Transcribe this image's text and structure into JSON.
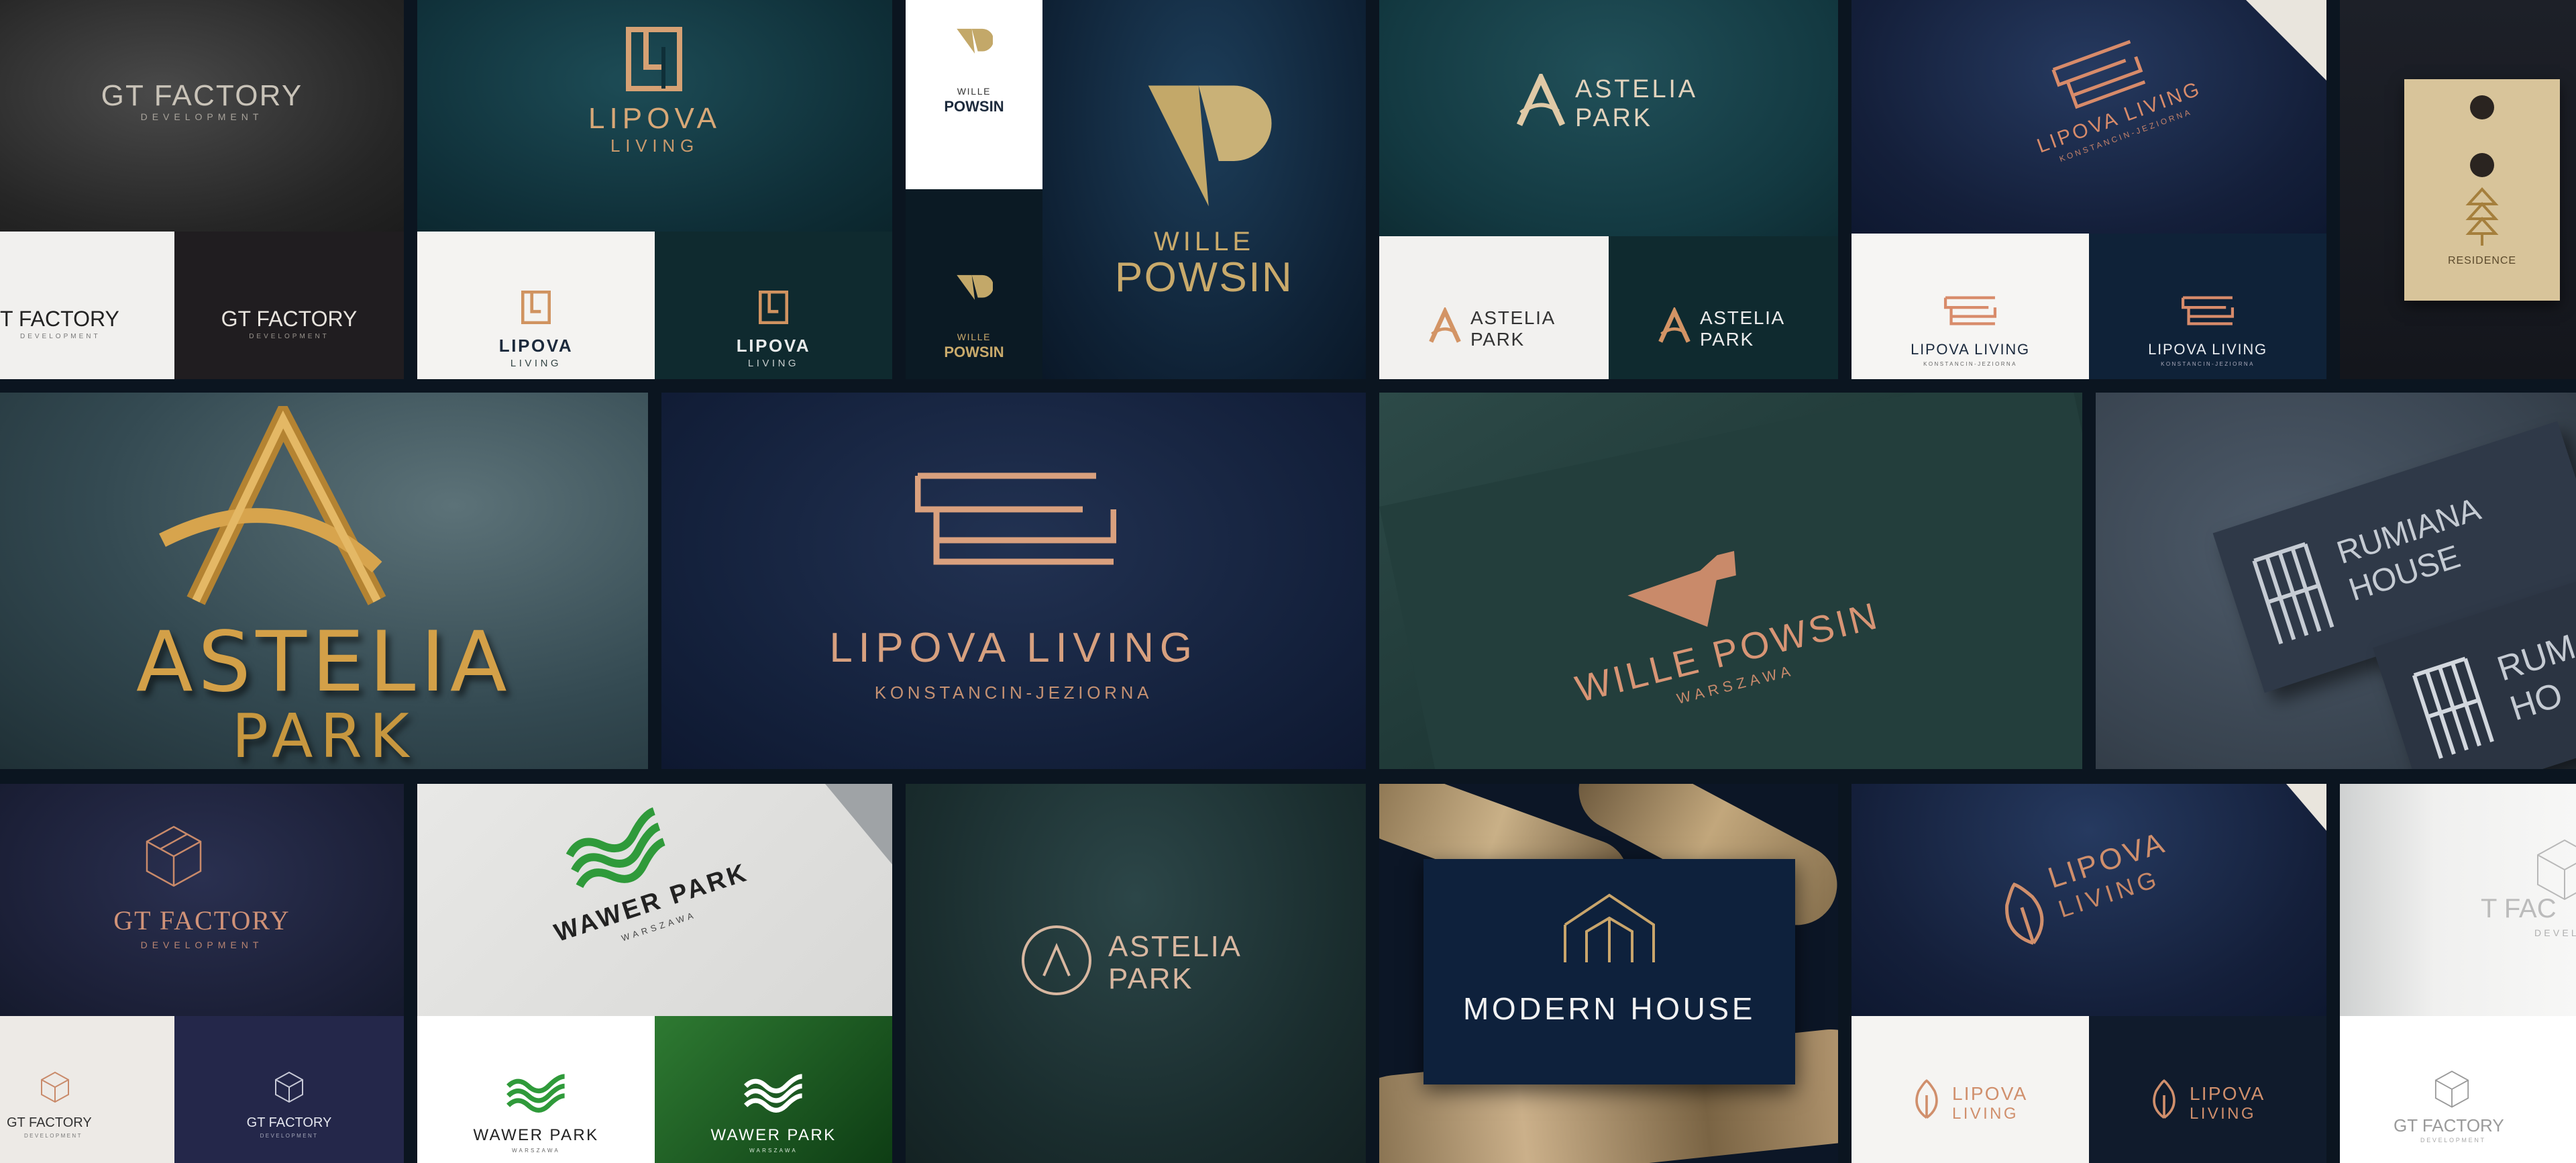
{
  "colors": {
    "background": "#0b1520",
    "gold": "#c9aa6b",
    "copper": "#c98a6a",
    "navy": "#101c33",
    "teal": "#123741",
    "green": "#2f9a3a"
  },
  "brands": {
    "gt_factory": {
      "name": "GT FACTORY",
      "sub": "DEVELOPMENT",
      "clipped_name": "T FACTORY",
      "far_clipped_name": "T FAC",
      "far_clipped_sub": "DEVEL"
    },
    "lipova": {
      "name_line1": "LIPOVA",
      "name_line2": "LIVING",
      "full_name": "LIPOVA LIVING",
      "location": "KONSTANCIN-JEZIORNA"
    },
    "wille": {
      "line1": "WILLE",
      "line2": "POWSIN",
      "full_name": "WILLE POWSIN",
      "location": "WARSZAWA"
    },
    "astelia": {
      "line1": "ASTELIA",
      "line2": "PARK"
    },
    "rumiana": {
      "line1": "RUMIANA",
      "line2": "HOUSE",
      "clip1": "RUM",
      "clip2": "HO"
    },
    "residence": {
      "name": "RESIDENCE"
    },
    "wawer": {
      "name": "WAWER PARK",
      "location": "WARSZAWA"
    },
    "modern_house": {
      "name": "MODERN HOUSE"
    }
  },
  "icons": {
    "gt": "geometric-cube-icon",
    "lipova_mono": "lipova-square-monogram-icon",
    "lipova_stripes": "lipova-stripes-icon",
    "lipova_leaf": "lipova-leaf-icon",
    "wille": "wille-v-monogram-icon",
    "astelia": "astelia-a-icon",
    "rumiana": "rumiana-rh-monogram-icon",
    "wawer": "wawer-wave-icon",
    "modern": "modern-house-outline-icon",
    "residence": "residence-tree-icon"
  }
}
